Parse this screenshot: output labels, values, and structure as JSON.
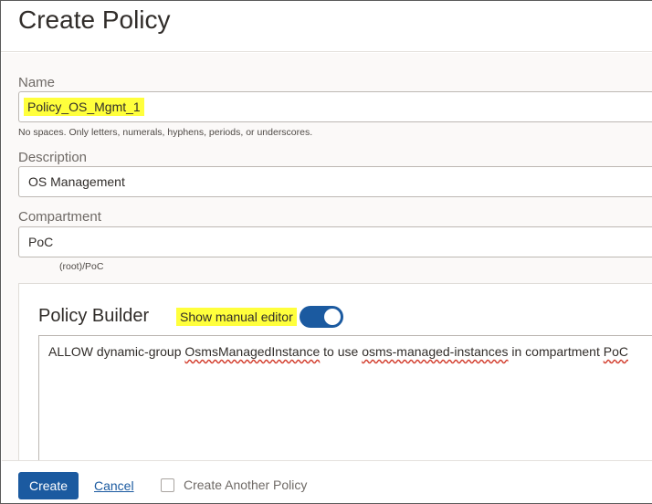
{
  "page": {
    "title": "Create Policy"
  },
  "form": {
    "name": {
      "label": "Name",
      "value": "Policy_OS_Mgmt_1",
      "hint": "No spaces. Only letters, numerals, hyphens, periods, or underscores."
    },
    "description": {
      "label": "Description",
      "value": "OS Management"
    },
    "compartment": {
      "label": "Compartment",
      "value": "PoC",
      "path": "(root)/PoC"
    }
  },
  "policy_builder": {
    "title": "Policy Builder",
    "manual_editor_label": "Show manual editor",
    "manual_editor_on": true,
    "statement": {
      "p1": "ALLOW dynamic-group ",
      "group": "OsmsManagedInstance",
      "p2": " to use ",
      "resource": "osms-managed-instances",
      "p3": " in compartment ",
      "compartment": "PoC"
    }
  },
  "footer": {
    "create_label": "Create",
    "cancel_label": "Cancel",
    "create_another_label": "Create Another Policy"
  },
  "colors": {
    "primary": "#1b5aa0",
    "highlight": "#ffff3c"
  }
}
